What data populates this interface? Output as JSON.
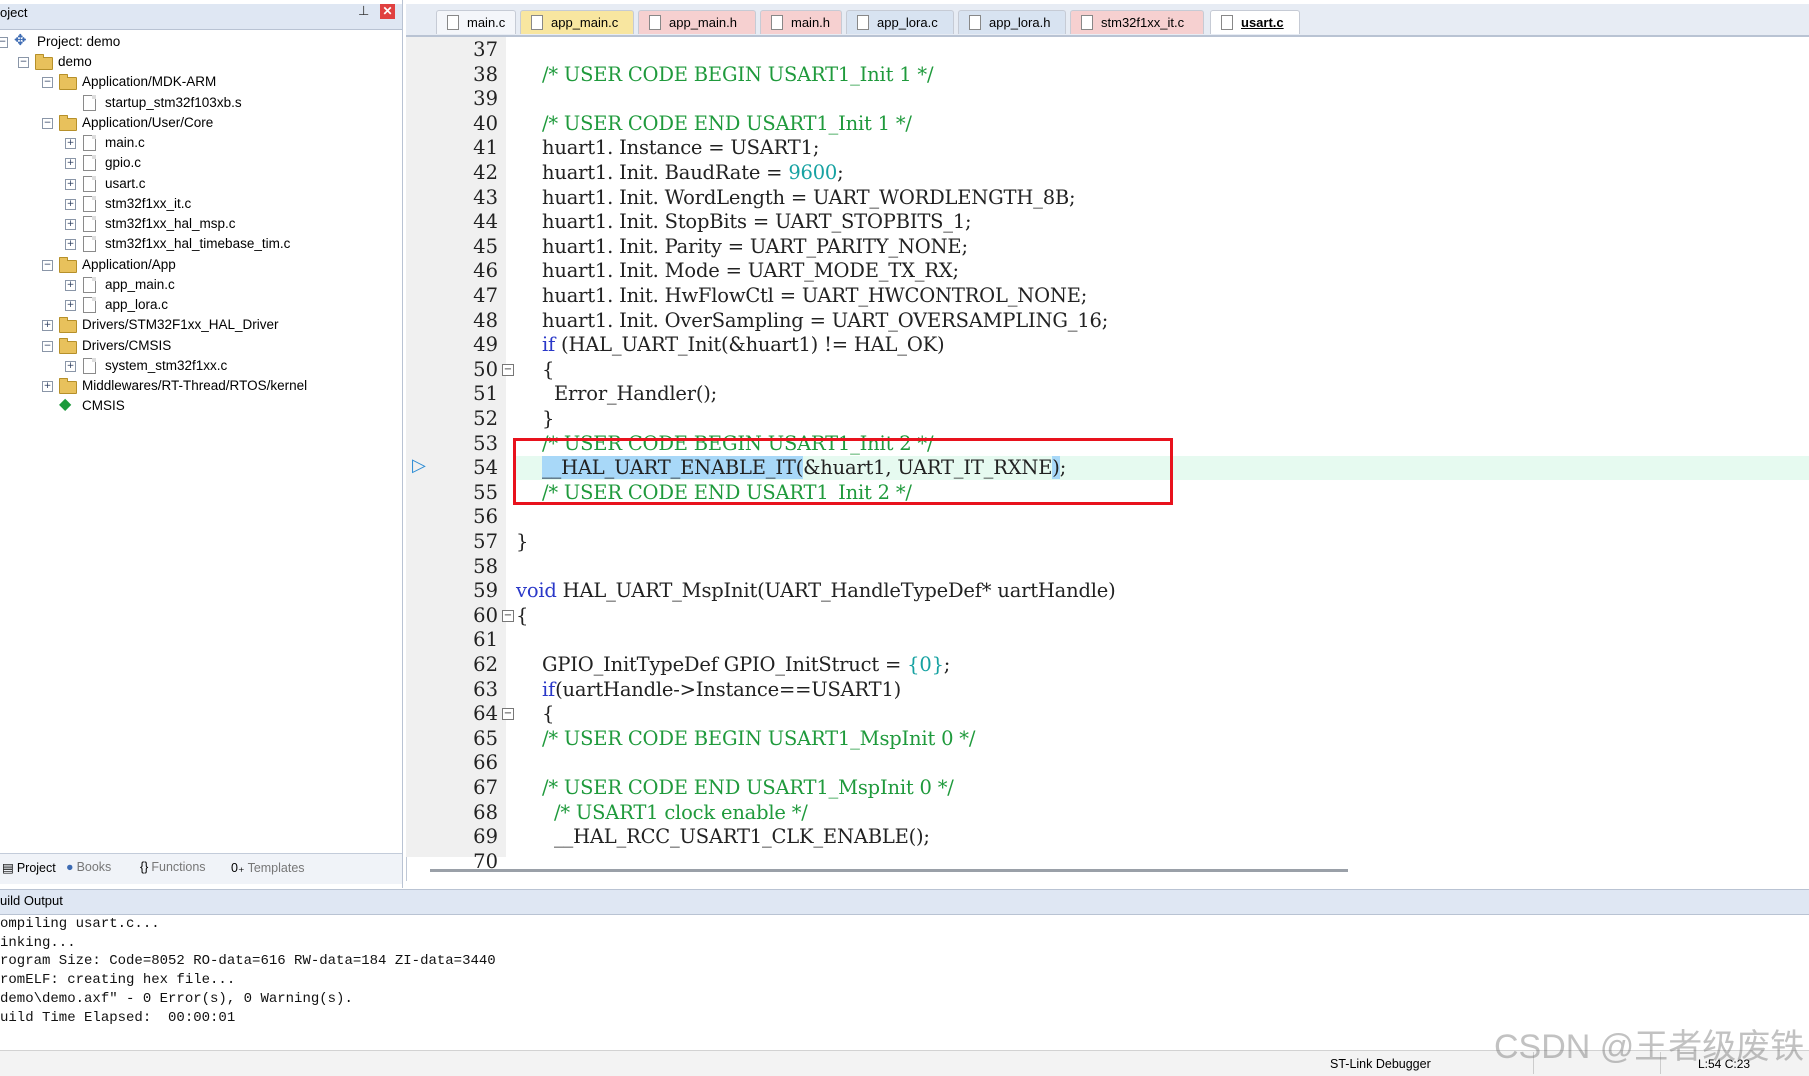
{
  "project_panel": {
    "title": "oject",
    "project_name": "Project: demo",
    "tree": [
      {
        "label": "demo",
        "type": "target"
      },
      {
        "label": "Application/MDK-ARM",
        "type": "folder"
      },
      {
        "label": "startup_stm32f103xb.s",
        "type": "file"
      },
      {
        "label": "Application/User/Core",
        "type": "folder"
      },
      {
        "label": "main.c",
        "type": "file"
      },
      {
        "label": "gpio.c",
        "type": "file"
      },
      {
        "label": "usart.c",
        "type": "file"
      },
      {
        "label": "stm32f1xx_it.c",
        "type": "file"
      },
      {
        "label": "stm32f1xx_hal_msp.c",
        "type": "file"
      },
      {
        "label": "stm32f1xx_hal_timebase_tim.c",
        "type": "file"
      },
      {
        "label": "Application/App",
        "type": "folder"
      },
      {
        "label": "app_main.c",
        "type": "file"
      },
      {
        "label": "app_lora.c",
        "type": "file"
      },
      {
        "label": "Drivers/STM32F1xx_HAL_Driver",
        "type": "folder"
      },
      {
        "label": "Drivers/CMSIS",
        "type": "folder"
      },
      {
        "label": "system_stm32f1xx.c",
        "type": "file"
      },
      {
        "label": "Middlewares/RT-Thread/RTOS/kernel",
        "type": "folder"
      },
      {
        "label": "CMSIS",
        "type": "component"
      }
    ],
    "tabs": [
      {
        "label": "Project",
        "icon": "project-tab-icon",
        "active": true
      },
      {
        "label": "Books",
        "icon": "books-icon",
        "active": false
      },
      {
        "label": "Functions",
        "icon": "braces-icon",
        "active": false
      },
      {
        "label": "Templates",
        "icon": "templates-icon",
        "active": false
      }
    ]
  },
  "editor_tabs": [
    {
      "label": "main.c",
      "style": "white"
    },
    {
      "label": "app_main.c",
      "style": "yellow"
    },
    {
      "label": "app_main.h",
      "style": "pink"
    },
    {
      "label": "main.h",
      "style": "pink"
    },
    {
      "label": "app_lora.c",
      "style": "blue"
    },
    {
      "label": "app_lora.h",
      "style": "blue"
    },
    {
      "label": "stm32f1xx_it.c",
      "style": "pink"
    },
    {
      "label": "usart.c",
      "style": "active"
    }
  ],
  "code": {
    "lines": [
      {
        "n": "37",
        "t": ""
      },
      {
        "n": "38",
        "t": "/* USER CODE BEGIN USART1_Init 1 */"
      },
      {
        "n": "39",
        "t": ""
      },
      {
        "n": "40",
        "t": "/* USER CODE END USART1_Init 1 */"
      },
      {
        "n": "41",
        "t": "huart1. Instance = USART1;"
      },
      {
        "n": "42",
        "t": "huart1. Init. BaudRate = 9600;"
      },
      {
        "n": "43",
        "t": "huart1. Init. WordLength = UART_WORDLENGTH_8B;"
      },
      {
        "n": "44",
        "t": "huart1. Init. StopBits = UART_STOPBITS_1;"
      },
      {
        "n": "45",
        "t": "huart1. Init. Parity = UART_PARITY_NONE;"
      },
      {
        "n": "46",
        "t": "huart1. Init. Mode = UART_MODE_TX_RX;"
      },
      {
        "n": "47",
        "t": "huart1. Init. HwFlowCtl = UART_HWCONTROL_NONE;"
      },
      {
        "n": "48",
        "t": "huart1. Init. OverSampling = UART_OVERSAMPLING_16;"
      },
      {
        "n": "49",
        "t": "if (HAL_UART_Init(&huart1) != HAL_OK)"
      },
      {
        "n": "50",
        "t": "{"
      },
      {
        "n": "51",
        "t": "  Error_Handler();"
      },
      {
        "n": "52",
        "t": "}"
      },
      {
        "n": "53",
        "t": "/* USER CODE BEGIN USART1_Init 2 */"
      },
      {
        "n": "54",
        "t": "__HAL_UART_ENABLE_IT(&huart1, UART_IT_RXNE);"
      },
      {
        "n": "55",
        "t": "/* USER CODE END USART1_Init 2 */"
      },
      {
        "n": "56",
        "t": ""
      },
      {
        "n": "57",
        "t": "}"
      },
      {
        "n": "58",
        "t": ""
      },
      {
        "n": "59",
        "t": "void HAL_UART_MspInit(UART_HandleTypeDef* uartHandle)"
      },
      {
        "n": "60",
        "t": "{"
      },
      {
        "n": "61",
        "t": ""
      },
      {
        "n": "62",
        "t": "GPIO_InitTypeDef GPIO_InitStruct = {0};"
      },
      {
        "n": "63",
        "t": "if(uartHandle->Instance==USART1)"
      },
      {
        "n": "64",
        "t": "{"
      },
      {
        "n": "65",
        "t": "/* USER CODE BEGIN USART1_MspInit 0 */"
      },
      {
        "n": "66",
        "t": ""
      },
      {
        "n": "67",
        "t": "/* USER CODE END USART1_MspInit 0 */"
      },
      {
        "n": "68",
        "t": "  /* USART1 clock enable */"
      },
      {
        "n": "69",
        "t": "  __HAL_RCC_USART1_CLK_ENABLE();"
      },
      {
        "n": "70",
        "t": ""
      }
    ]
  },
  "build_output": {
    "title": "uild Output",
    "lines": [
      "ompiling usart.c...",
      "inking...",
      "rogram Size: Code=8052 RO-data=616 RW-data=184 ZI-data=3440",
      "romELF: creating hex file...",
      "demo\\demo.axf\" - 0 Error(s), 0 Warning(s).",
      "uild Time Elapsed:  00:00:01"
    ]
  },
  "status": {
    "debugger": "ST-Link Debugger",
    "position": "L:54 C:23"
  },
  "watermark": "CSDN @王者级废铁",
  "colors": {
    "comment": "#1f9a3c",
    "keyword": "#2a38c8",
    "number": "#16a2a2",
    "highlight_box": "#e8121d",
    "selection": "#a8d8f8"
  }
}
